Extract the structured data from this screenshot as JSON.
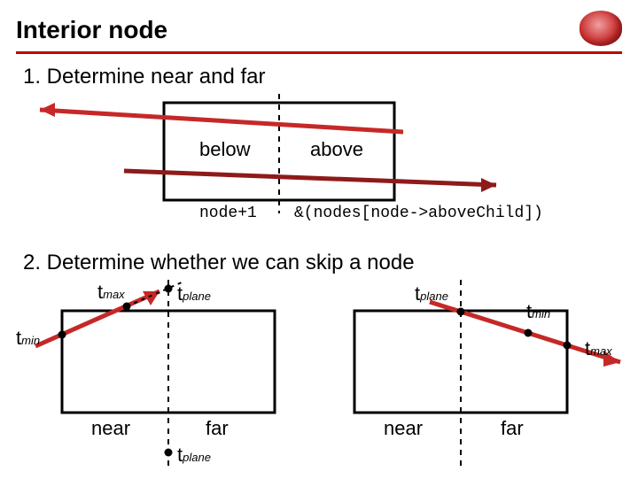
{
  "title": "Interior node",
  "steps": {
    "1": "1.  Determine near and far",
    "2": "2.  Determine whether we can skip a node"
  },
  "diagram1": {
    "left_label": "below",
    "right_label": "above",
    "code_left": "node+1",
    "code_right": "&(nodes[node->aboveChild])"
  },
  "diagram2": {
    "near": "near",
    "far": "far",
    "tplane": "tplane",
    "tmin": "tmin",
    "tmax": "tmax"
  },
  "colors": {
    "accent": "#c20000",
    "arrow": "#c62828",
    "arrow_dark": "#8e1a1a"
  }
}
